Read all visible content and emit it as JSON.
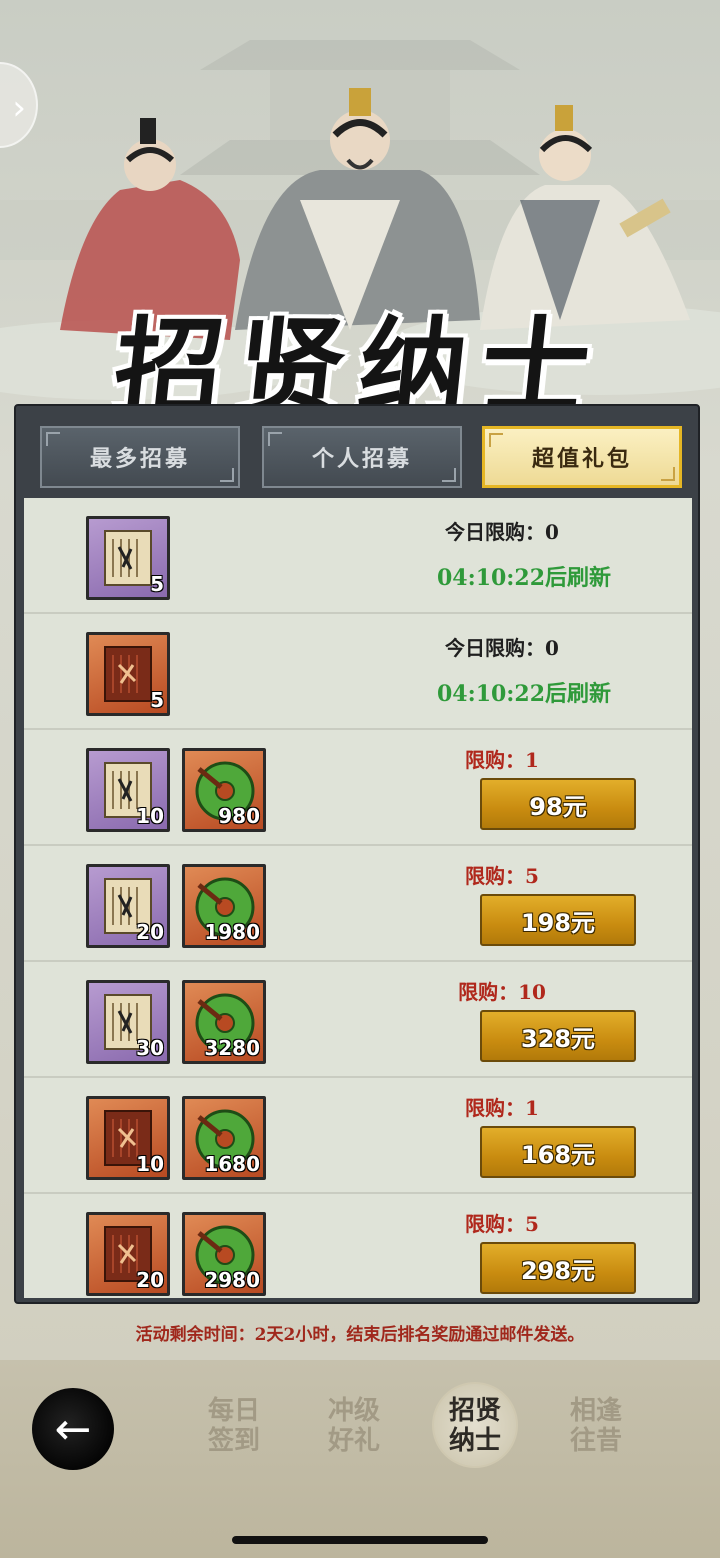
{
  "header": {
    "title": "招贤纳士"
  },
  "tabs": [
    {
      "label": "最多招募",
      "active": false
    },
    {
      "label": "个人招募",
      "active": false
    },
    {
      "label": "超值礼包",
      "active": true
    }
  ],
  "rows": [
    {
      "items": [
        {
          "type": "scroll-purple",
          "qty": "5"
        }
      ],
      "limit": "今日限购：0",
      "refresh": "04:10:22后刷新"
    },
    {
      "items": [
        {
          "type": "scroll-red",
          "qty": "5"
        }
      ],
      "limit": "今日限购：0",
      "refresh": "04:10:22后刷新"
    },
    {
      "items": [
        {
          "type": "scroll-purple",
          "qty": "10"
        },
        {
          "type": "jade",
          "qty": "980"
        }
      ],
      "limit": "限购：1",
      "price": "98元"
    },
    {
      "items": [
        {
          "type": "scroll-purple",
          "qty": "20"
        },
        {
          "type": "jade",
          "qty": "1980"
        }
      ],
      "limit": "限购：5",
      "price": "198元"
    },
    {
      "items": [
        {
          "type": "scroll-purple",
          "qty": "30"
        },
        {
          "type": "jade",
          "qty": "3280"
        }
      ],
      "limit": "限购：10",
      "price": "328元"
    },
    {
      "items": [
        {
          "type": "scroll-red",
          "qty": "10"
        },
        {
          "type": "jade",
          "qty": "1680"
        }
      ],
      "limit": "限购：1",
      "price": "168元"
    },
    {
      "items": [
        {
          "type": "scroll-red",
          "qty": "20"
        },
        {
          "type": "jade",
          "qty": "2980"
        }
      ],
      "limit": "限购：5",
      "price": "298元"
    }
  ],
  "footer_note": "活动剩余时间：2天2小时，结束后排名奖励通过邮件发送。",
  "bottom_nav": [
    {
      "line1": "每日",
      "line2": "签到",
      "active": false
    },
    {
      "line1": "冲级",
      "line2": "好礼",
      "active": false
    },
    {
      "line1": "招贤",
      "line2": "纳士",
      "active": true
    },
    {
      "line1": "相逢",
      "line2": "往昔",
      "active": false
    }
  ],
  "colors": {
    "active_tab_border": "#e5b624",
    "refresh_green": "#2f9a3a",
    "limit_red": "#b0281c",
    "price_gold": "#c98c10"
  },
  "icons": {
    "back": "back-arrow-icon",
    "side": "chevron-right-icon"
  }
}
